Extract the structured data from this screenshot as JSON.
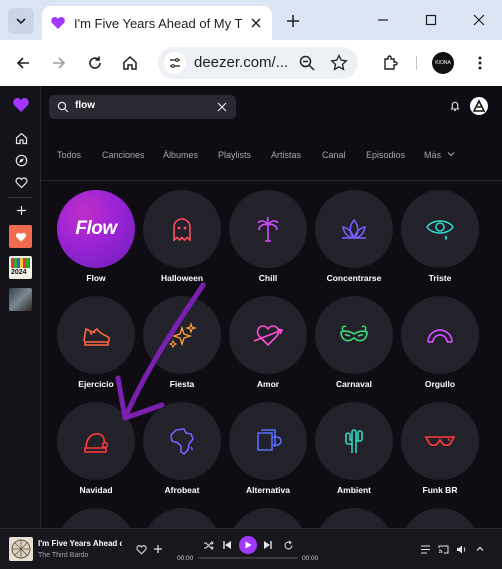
{
  "browser": {
    "tab_title": "I'm Five Years Ahead of My Tim",
    "url": "deezer.com/...",
    "profile_label": "KIONA"
  },
  "app": {
    "search": {
      "query": "flow"
    },
    "filters": [
      "Todos",
      "Canciones",
      "Álbumes",
      "Playlists",
      "Artistas",
      "Canal",
      "Episodios",
      "Más"
    ],
    "tiles": [
      {
        "label": "Flow",
        "icon": "flow-badge",
        "color": "#ffffff",
        "cover_text": "Flow"
      },
      {
        "label": "Halloween",
        "icon": "ghost-icon",
        "color": "#ff4d5e"
      },
      {
        "label": "Chill",
        "icon": "palm-tree-icon",
        "color": "#d14cff"
      },
      {
        "label": "Concentrarse",
        "icon": "lotus-icon",
        "color": "#7a5cff"
      },
      {
        "label": "Triste",
        "icon": "crying-eye-icon",
        "color": "#2fd6c4"
      },
      {
        "label": "Ejercicio",
        "icon": "sneaker-icon",
        "color": "#ff6a3d"
      },
      {
        "label": "Fiesta",
        "icon": "sparkles-icon",
        "color": "#ff9b3d"
      },
      {
        "label": "Amor",
        "icon": "heart-arrow-icon",
        "color": "#ff4fd8"
      },
      {
        "label": "Carnaval",
        "icon": "carnival-mask-icon",
        "color": "#3de07a"
      },
      {
        "label": "Orgullo",
        "icon": "rainbow-icon",
        "color": "#d14cff"
      },
      {
        "label": "Navidad",
        "icon": "santa-hat-icon",
        "color": "#ff3b3b"
      },
      {
        "label": "Afrobeat",
        "icon": "africa-map-icon",
        "color": "#7a5cff"
      },
      {
        "label": "Alternativa",
        "icon": "mug-icon",
        "color": "#5a6cff"
      },
      {
        "label": "Ambient",
        "icon": "cactus-icon",
        "color": "#2fd6c4"
      },
      {
        "label": "Funk BR",
        "icon": "sunglasses-icon",
        "color": "#ff3b3b"
      }
    ],
    "player": {
      "title": "I'm Five Years Ahead of My Time",
      "artist": "The Third Bardo",
      "time_elapsed": "00:00",
      "time_total": "00:00"
    },
    "sidebar_thumb_label": "2024"
  },
  "colors": {
    "accent": "#a238ff",
    "annotation_arrow": "#7a1fb0"
  }
}
